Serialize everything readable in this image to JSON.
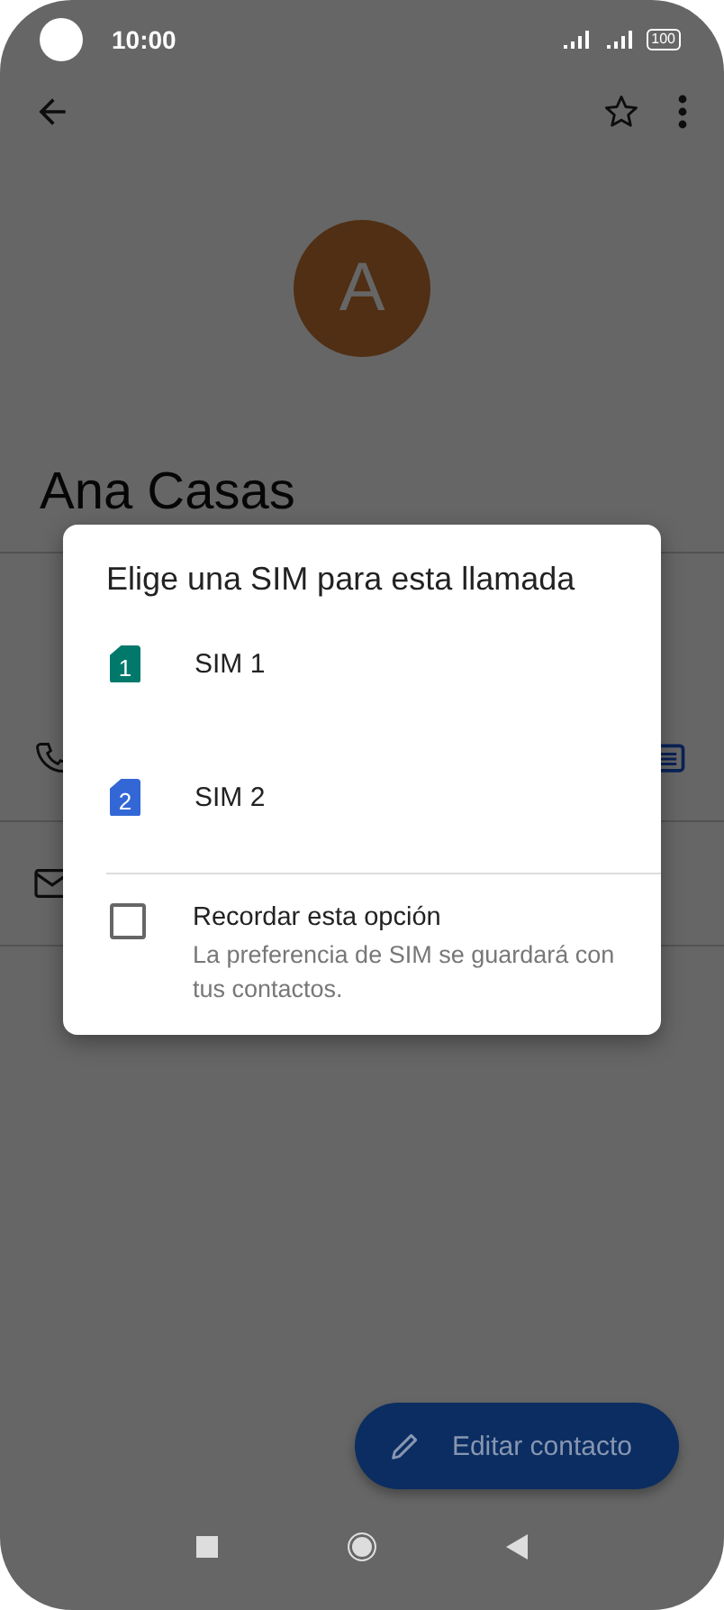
{
  "status_bar": {
    "time": "10:00",
    "battery": "100"
  },
  "contact": {
    "avatar_letter": "A",
    "name": "Ana Casas"
  },
  "dialog": {
    "title": "Elige una SIM para esta llamada",
    "options": [
      {
        "badge": "1",
        "label": "SIM 1",
        "color": "#00796b"
      },
      {
        "badge": "2",
        "label": "SIM 2",
        "color": "#3367d6"
      }
    ],
    "remember": {
      "label": "Recordar esta opción",
      "description": "La preferencia de SIM se guardará con tus contactos.",
      "checked": false
    }
  },
  "fab": {
    "label": "Editar contacto"
  }
}
